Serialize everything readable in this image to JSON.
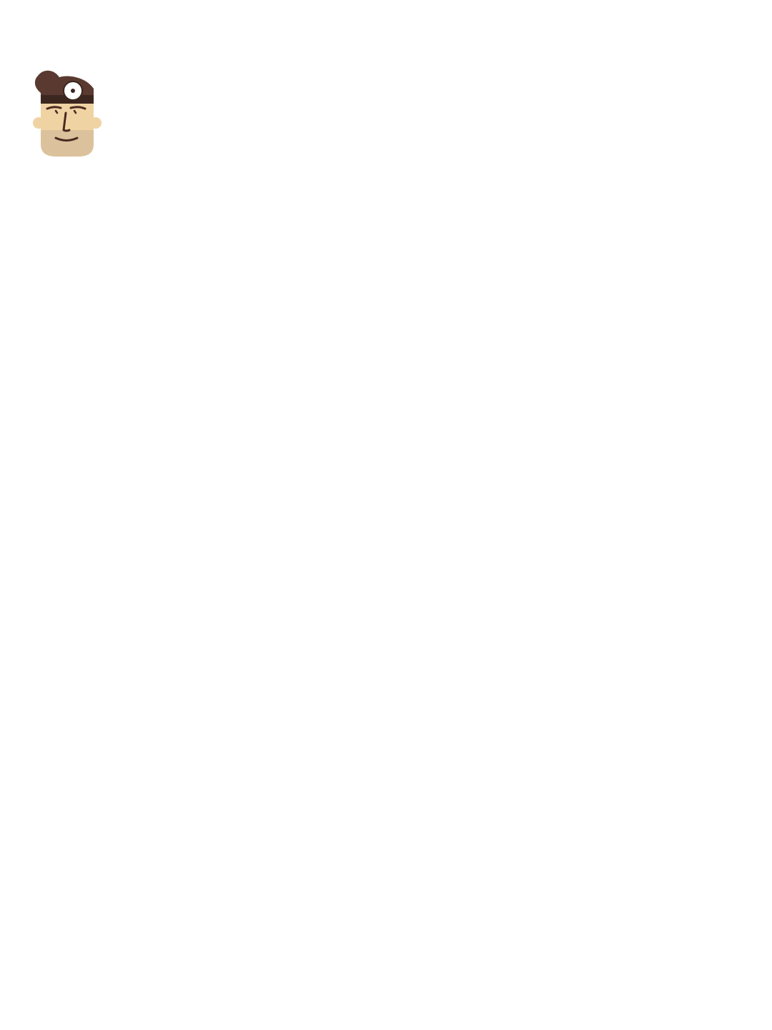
{
  "avatar": {
    "icon": "doctor-avatar-icon",
    "colors": {
      "hair": "#5a3a30",
      "hair_band": "#3b2620",
      "skin_upper": "#f0d3a3",
      "skin_lower": "#dcc29c",
      "ear": "#f0d3a3",
      "features": "#4a2a22",
      "mirror_white": "#ffffff",
      "mirror_center": "#3b2620"
    }
  }
}
